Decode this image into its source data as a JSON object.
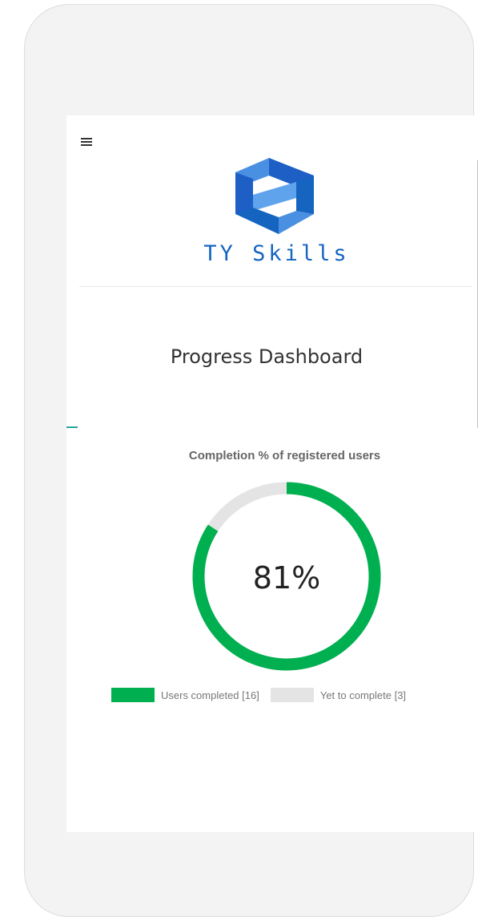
{
  "header": {
    "brand_name": "TY Skills",
    "logo_icon": "stacked-cube-logo-icon",
    "menu_icon": "hamburger-menu-icon"
  },
  "main": {
    "page_title": "Progress Dashboard"
  },
  "colors": {
    "completed": "#00b050",
    "pending": "#e4e4e4",
    "brand_blue": "#1565c0",
    "accent": "#26a69a"
  },
  "chart_data": {
    "type": "pie",
    "title": "Completion % of registered users",
    "center_label": "81%",
    "series": [
      {
        "name": "Users completed",
        "value": 16,
        "legend_label": "Users completed [16]"
      },
      {
        "name": "Yet to complete",
        "value": 3,
        "legend_label": "Yet to complete [3]"
      }
    ],
    "legend_position": "bottom"
  },
  "scroll": {
    "up_glyph": "▲",
    "down_glyph": "▼"
  }
}
